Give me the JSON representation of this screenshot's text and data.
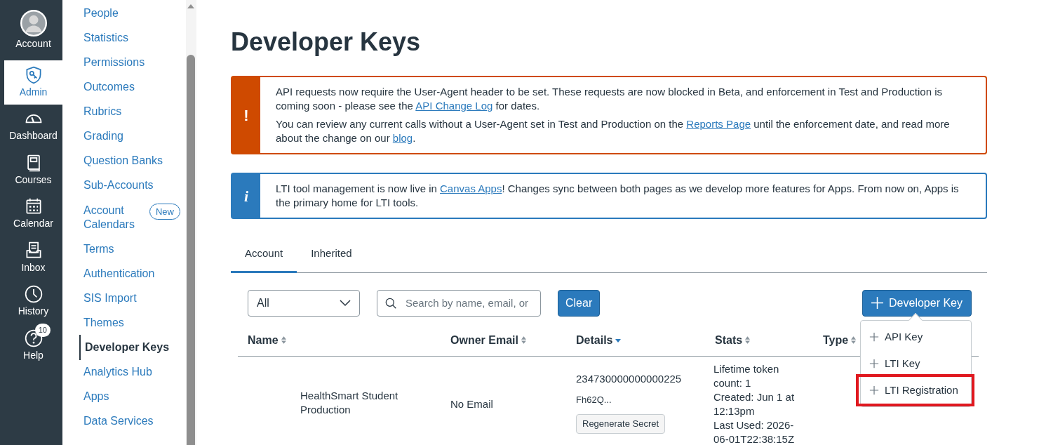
{
  "global_nav": [
    {
      "label": "Account",
      "selected": false
    },
    {
      "label": "Admin",
      "selected": true
    },
    {
      "label": "Dashboard",
      "selected": false
    },
    {
      "label": "Courses",
      "selected": false
    },
    {
      "label": "Calendar",
      "selected": false
    },
    {
      "label": "Inbox",
      "selected": false
    },
    {
      "label": "History",
      "selected": false
    },
    {
      "label": "Help",
      "selected": false,
      "badge": "10"
    }
  ],
  "sidebar": {
    "items": [
      {
        "label": "People",
        "selected": false
      },
      {
        "label": "Statistics",
        "selected": false
      },
      {
        "label": "Permissions",
        "selected": false
      },
      {
        "label": "Outcomes",
        "selected": false
      },
      {
        "label": "Rubrics",
        "selected": false
      },
      {
        "label": "Grading",
        "selected": false
      },
      {
        "label": "Question Banks",
        "selected": false
      },
      {
        "label": "Sub-Accounts",
        "selected": false
      },
      {
        "label": "Account Calendars",
        "selected": false,
        "tag": "New"
      },
      {
        "label": "Terms",
        "selected": false
      },
      {
        "label": "Authentication",
        "selected": false
      },
      {
        "label": "SIS Import",
        "selected": false
      },
      {
        "label": "Themes",
        "selected": false
      },
      {
        "label": "Developer Keys",
        "selected": true
      },
      {
        "label": "Analytics Hub",
        "selected": false
      },
      {
        "label": "Apps",
        "selected": false
      },
      {
        "label": "Data Services",
        "selected": false
      }
    ]
  },
  "page": {
    "title": "Developer Keys"
  },
  "alerts": [
    {
      "kind": "warning",
      "icon": "!",
      "paragraphs": [
        [
          {
            "text": "API requests now require the User-Agent header to be set. These requests are now blocked in Beta, and enforcement in Test and Production is coming soon - please see the "
          },
          {
            "link": "API Change Log"
          },
          {
            "text": " for dates."
          }
        ],
        [
          {
            "text": "You can review any current calls without a User-Agent set in Test and Production on the "
          },
          {
            "link": "Reports Page"
          },
          {
            "text": " until the enforcement date, and read more about the change on our "
          },
          {
            "link": "blog"
          },
          {
            "text": "."
          }
        ]
      ]
    },
    {
      "kind": "info",
      "icon": "i",
      "paragraphs": [
        [
          {
            "text": "LTI tool management is now live in "
          },
          {
            "link": "Canvas Apps"
          },
          {
            "text": "! Changes sync between both pages as we develop more features for Apps. From now on, Apps is the primary home for LTI tools."
          }
        ]
      ]
    }
  ],
  "tabs": [
    {
      "label": "Account",
      "selected": true
    },
    {
      "label": "Inherited",
      "selected": false
    }
  ],
  "filter": {
    "value": "All"
  },
  "search": {
    "placeholder": "Search by name, email, or"
  },
  "clear_button": "Clear",
  "add_button": "Developer Key",
  "add_menu": [
    {
      "label": "API Key",
      "highlighted": false
    },
    {
      "label": "LTI Key",
      "highlighted": false
    },
    {
      "label": "LTI Registration",
      "highlighted": true
    }
  ],
  "table": {
    "columns": [
      {
        "label": "Name",
        "sorted": false
      },
      {
        "label": "Owner Email",
        "sorted": false
      },
      {
        "label": "Details",
        "sorted": true
      },
      {
        "label": "Stats",
        "sorted": false
      },
      {
        "label": "Type",
        "sorted": false
      }
    ],
    "rows": [
      {
        "name": "HealthSmart Student Production",
        "email": "No Email",
        "id": "234730000000000225",
        "secret": "Fh62Q...",
        "secret_button": "Regenerate Secret",
        "stats": [
          "Lifetime token count: 1",
          "Created: Jun 1 at 12:13pm",
          "Last Used: 2026-06-01T22:38:15Z"
        ]
      }
    ]
  }
}
